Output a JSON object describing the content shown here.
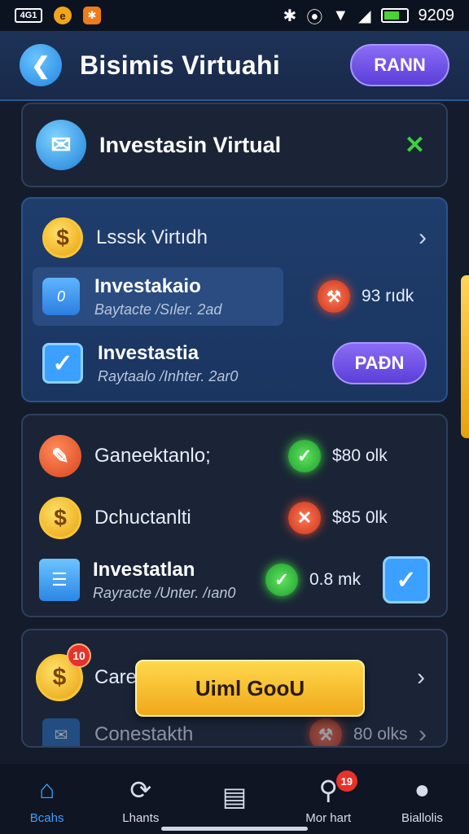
{
  "status_bar": {
    "left_box": "4G1",
    "time": "9209"
  },
  "header": {
    "back_icon": "back-arrow-icon",
    "title": "Bisimis Virtuahi",
    "button": "RANN"
  },
  "top_card": {
    "icon": "mail-icon",
    "title": "Investasin Virtual",
    "close_icon": "close-icon"
  },
  "blue_card": {
    "header": {
      "label": "Lsssk Virtıdh"
    },
    "items": [
      {
        "title": "Investakaio",
        "subtitle": "Baytacte /Sıler. 2ad",
        "value": "93 rıdk"
      },
      {
        "title": "Investastia",
        "subtitle": "Raytaalo /Inhter. 2ar0",
        "button": "PAÐN"
      }
    ]
  },
  "list_card": {
    "items": [
      {
        "title": "Ganeektanlo;",
        "status": "check",
        "value": "$80 olk"
      },
      {
        "title": "Dchuctanlti",
        "status": "cross",
        "value": "$85 0lk"
      },
      {
        "title": "Investatlan",
        "subtitle": "Rayracte /Unter. /ıan0",
        "status": "check",
        "value": "0.8 mk"
      }
    ]
  },
  "bottom_card": {
    "badge": "10",
    "item1_title": "Care",
    "overlay_button": "Uiml GooU",
    "item2_title": "Conestakth",
    "item2_value": "80 olks"
  },
  "nav": {
    "items": [
      {
        "label": "Bcahs",
        "icon": "home-icon"
      },
      {
        "label": "Lhants",
        "icon": "refresh-icon"
      },
      {
        "label": "",
        "icon": "clipboard-icon"
      },
      {
        "label": "Mor hart",
        "icon": "search-icon",
        "badge": "19"
      },
      {
        "label": "Biallolis",
        "icon": "profile-icon"
      }
    ]
  },
  "colors": {
    "accent": "#3aa0ff",
    "button_purple": "#6b4fe6",
    "gold": "#f5b820",
    "success": "#2dbd3a",
    "danger": "#d9381e"
  }
}
